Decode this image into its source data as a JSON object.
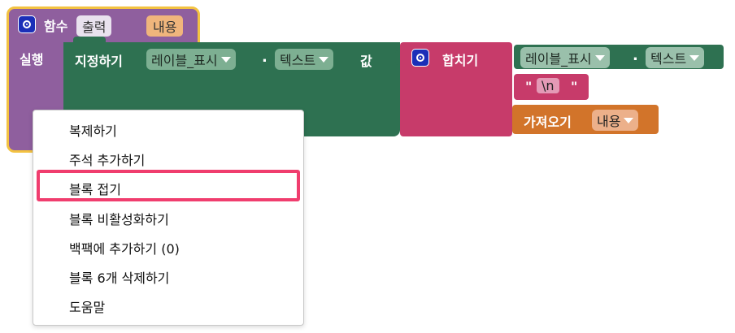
{
  "procedure_block": {
    "keyword": "함수",
    "name": "출력",
    "param": "내용",
    "do_label": "실행"
  },
  "set_block": {
    "keyword": "지정하기",
    "component": "레이블_표시",
    "dot": ".",
    "property": "텍스트",
    "to_label": "값"
  },
  "join_block": {
    "keyword": "합치기"
  },
  "getter_block": {
    "component": "레이블_표시",
    "dot": ".",
    "property": "텍스트"
  },
  "text_block": {
    "open_quote": "\"",
    "value": "\\n",
    "close_quote": "\""
  },
  "get_local_block": {
    "keyword": "가져오기",
    "variable": "내용"
  },
  "context_menu": {
    "items": [
      "복제하기",
      "주석 추가하기",
      "블록 접기",
      "블록 비활성화하기",
      "백팩에 추가하기 (0)",
      "블록 6개 삭제하기",
      "도움말"
    ],
    "highlighted_index": 2
  },
  "colors": {
    "procedure": "#8f5f9e",
    "procedure_outline": "#f3c241",
    "set_block": "#2e7151",
    "join_block": "#c73b6a",
    "get_local": "#d2742a",
    "highlight": "#f03d6e"
  }
}
